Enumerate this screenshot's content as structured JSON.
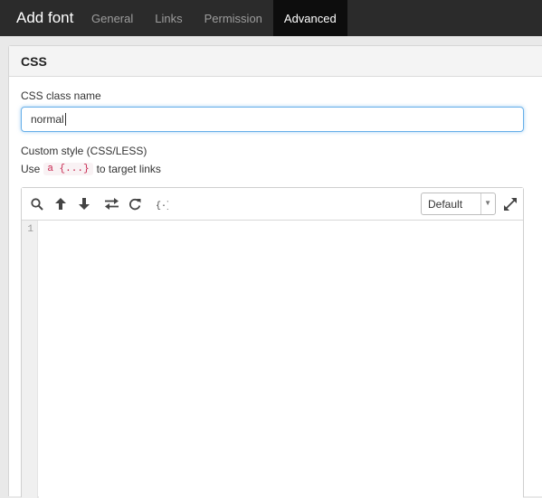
{
  "header": {
    "title": "Add font",
    "tabs": [
      {
        "label": "General"
      },
      {
        "label": "Links"
      },
      {
        "label": "Permission"
      },
      {
        "label": "Advanced",
        "active": true
      }
    ]
  },
  "section": {
    "title": "CSS",
    "class_label": "CSS class name",
    "class_value": "normal",
    "custom_label": "Custom style (CSS/LESS)",
    "hint_prefix": "Use",
    "hint_code": "a {...}",
    "hint_suffix": "to target links"
  },
  "editor": {
    "toolbar_icons": [
      "search-icon",
      "arrow-up-icon",
      "arrow-down-icon",
      "replace-icon",
      "refresh-icon",
      "braces-icon"
    ],
    "theme_select": "Default",
    "line_numbers": [
      "1"
    ]
  },
  "colors": {
    "topbar_bg": "#2b2b2b",
    "active_tab_bg": "#0d0d0d",
    "input_focus": "#66afe9",
    "code_color": "#c7254e"
  }
}
